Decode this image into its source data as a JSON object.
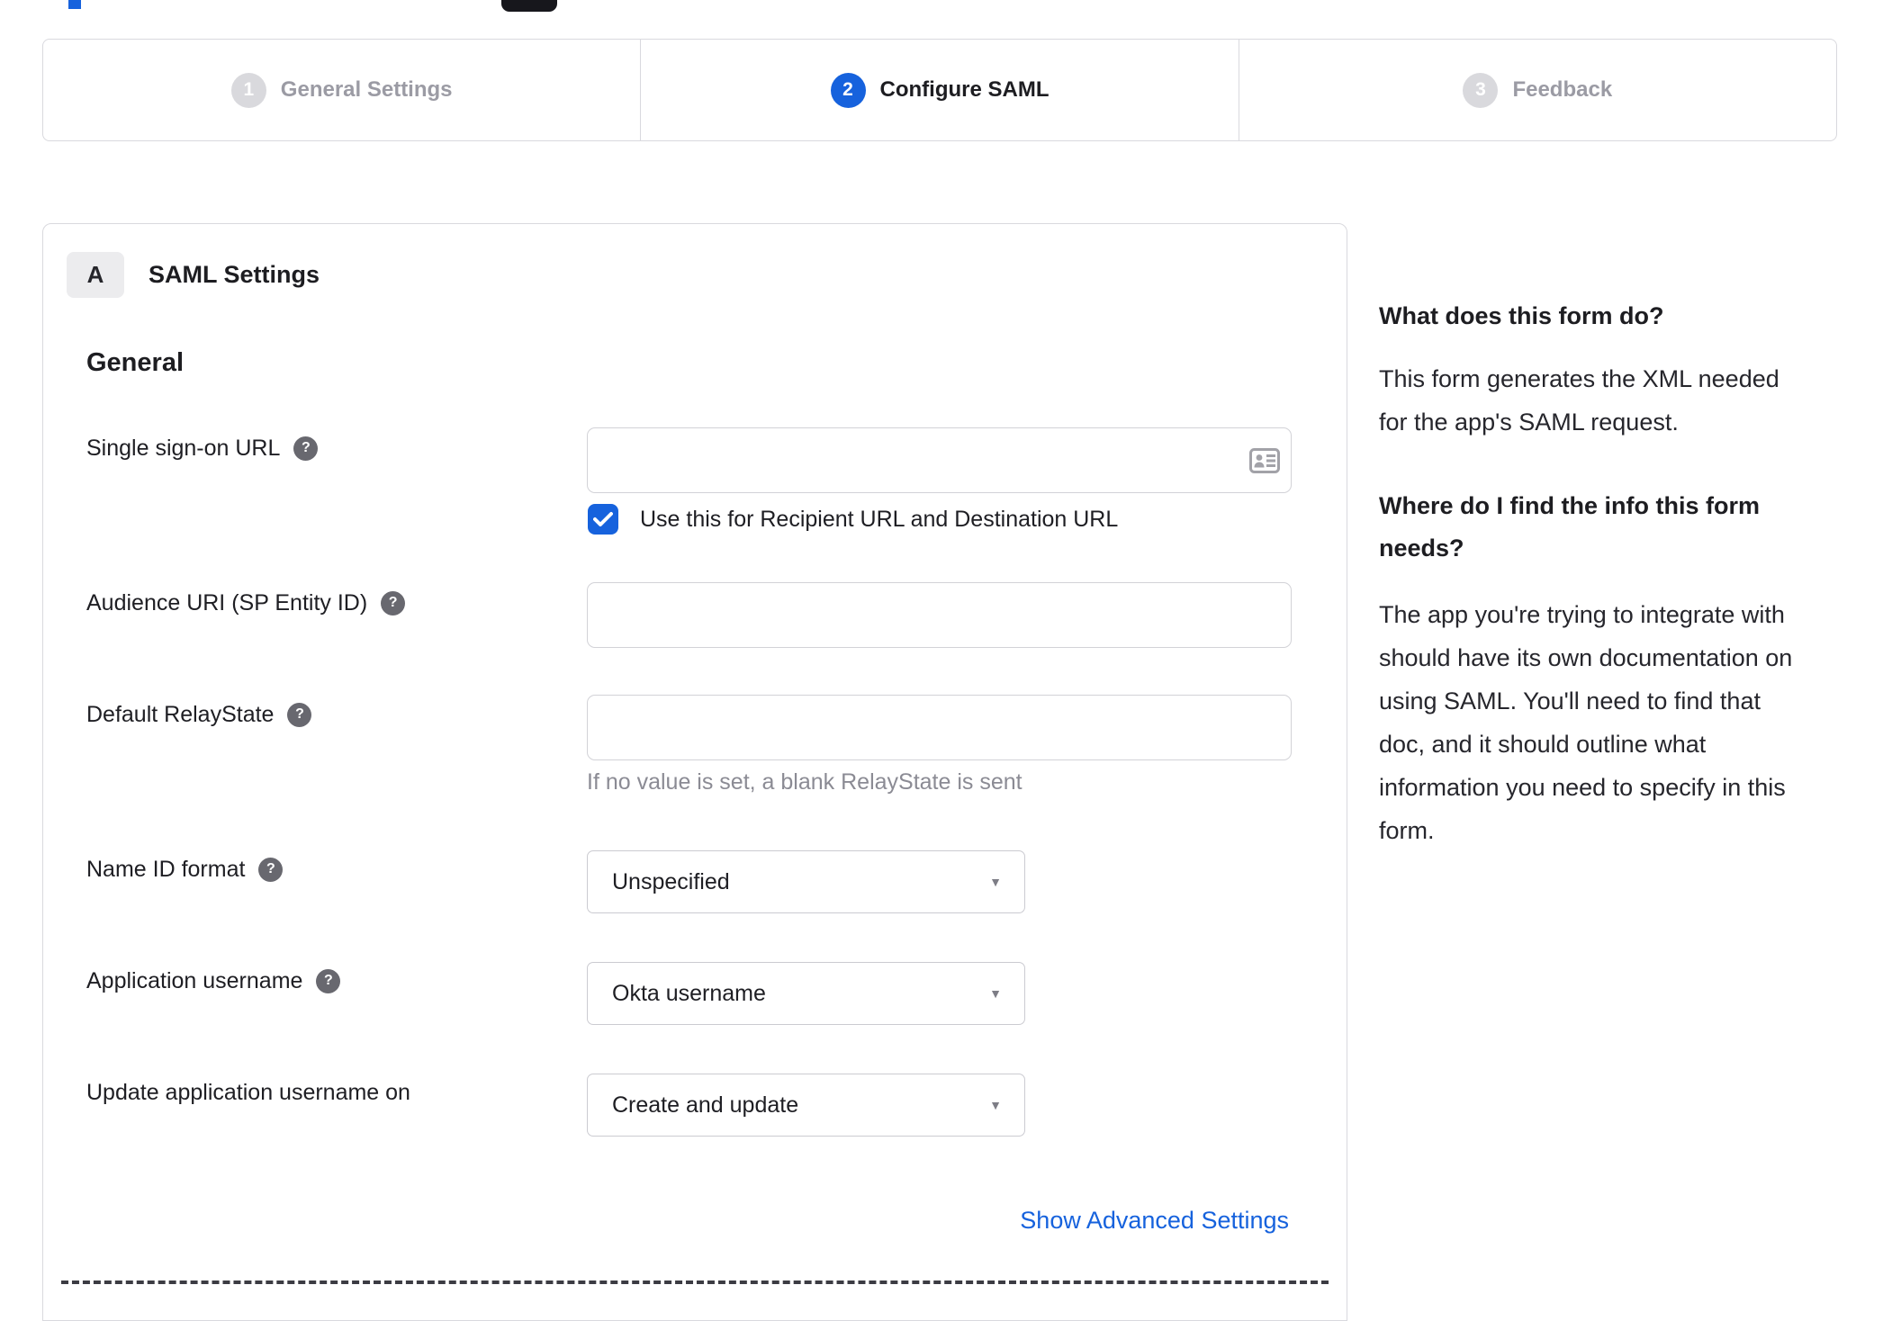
{
  "colors": {
    "accent": "#1662dd"
  },
  "stepper": {
    "steps": [
      {
        "num": "1",
        "label": "General Settings"
      },
      {
        "num": "2",
        "label": "Configure SAML"
      },
      {
        "num": "3",
        "label": "Feedback"
      }
    ]
  },
  "panel": {
    "badge": "A",
    "title": "SAML Settings",
    "section": "General",
    "rows": [
      {
        "label": "Single sign-on URL",
        "value": "",
        "checkbox_label": "Use this for Recipient URL and Destination URL"
      },
      {
        "label": "Audience URI (SP Entity ID)",
        "value": ""
      },
      {
        "label": "Default RelayState",
        "value": "",
        "hint": "If no value is set, a blank RelayState is sent"
      },
      {
        "label": "Name ID format",
        "value": "Unspecified"
      },
      {
        "label": "Application username",
        "value": "Okta username"
      },
      {
        "label": "Update application username on",
        "value": "Create and update"
      }
    ],
    "advanced_link": "Show Advanced Settings"
  },
  "sidebar": {
    "heading1": "What does this form do?",
    "para1_lines": [
      "This form generates the XML needed",
      "for the app's SAML request."
    ],
    "heading2_lines": [
      "Where do I find the info this form",
      "needs?"
    ],
    "para2_lines": [
      "The app you're trying to integrate with",
      "should have its own documentation on",
      "using SAML. You'll need to find that",
      "doc, and it should outline what",
      "information you need to specify in this",
      "form."
    ]
  }
}
